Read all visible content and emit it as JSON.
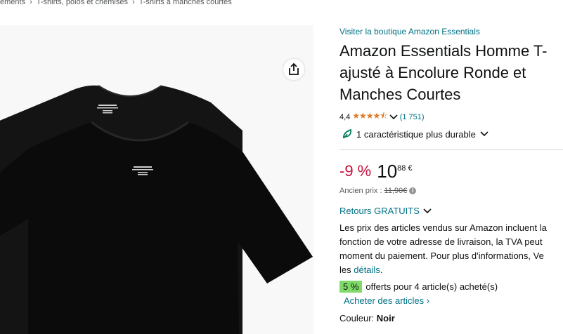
{
  "breadcrumb": {
    "items": [
      "ements",
      "T-shirts, polos et chemises",
      "T-shirts à manches courtes"
    ],
    "separator": "›"
  },
  "gallery": {
    "share_icon": "share-icon",
    "product_image": "black-tshirts-two-pack"
  },
  "product": {
    "store_link": "Visiter la boutique Amazon Essentials",
    "title": "Amazon Essentials Homme T-shirt ajusté à Encolure Ronde et Manches Courtes",
    "title_lines": [
      "Amazon Essentials Homme T-",
      "ajusté à Encolure Ronde et",
      "Manches Courtes"
    ],
    "rating_value": "4,4",
    "rating_stars": "★★★★⯪",
    "rating_count": "(1 751)",
    "sustainability": "1 caractéristique plus durable",
    "discount": "-9 %",
    "price_int": "10",
    "price_frac": "88 €",
    "old_price_label": "Ancien prix :",
    "old_price": "11,90€",
    "returns": "Retours GRATUITS",
    "tax_lines": [
      "Les prix des articles vendus sur Amazon incluent la",
      "fonction de votre adresse de livraison, la TVA peut",
      "moment du paiement. Pour plus d'informations, Ve"
    ],
    "tax_prefix": "les ",
    "tax_link": "détails",
    "tax_suffix": ".",
    "promo_badge": "5 %",
    "promo_text": "offerts pour 4 article(s) acheté(s)",
    "buy_link": "Acheter des articles ›",
    "color_label": "Couleur:",
    "color_value": "Noir"
  },
  "colors": {
    "link": "#007185",
    "discount": "#cc0c39",
    "star": "#de7921",
    "promo_badge": "#7fda69"
  }
}
